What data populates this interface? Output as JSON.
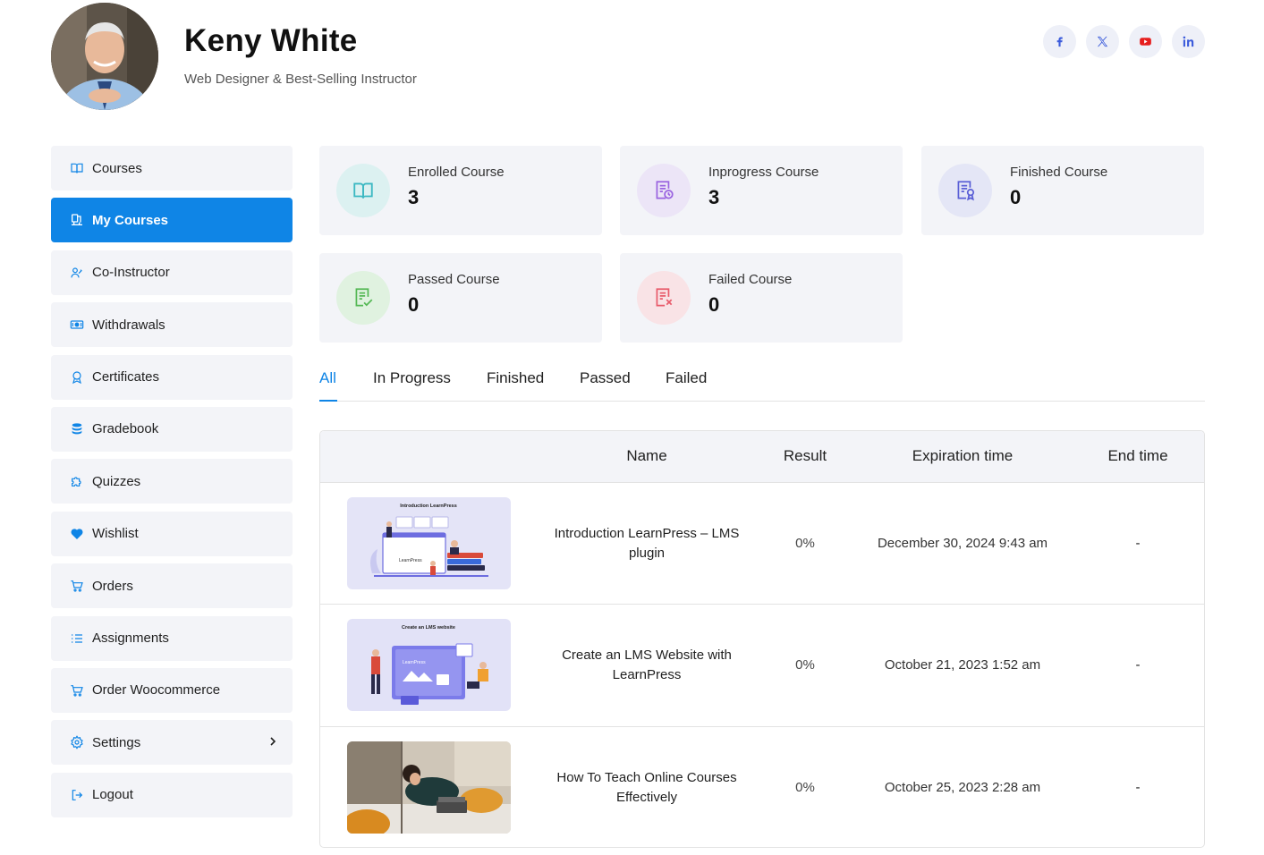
{
  "profile": {
    "name": "Keny White",
    "role": "Web Designer & Best-Selling Instructor"
  },
  "socials": [
    {
      "icon": "facebook-icon",
      "color": "#3b5bdb"
    },
    {
      "icon": "x-icon",
      "color": "#3b5bdb"
    },
    {
      "icon": "youtube-icon",
      "color": "#e61e1e"
    },
    {
      "icon": "linkedin-icon",
      "color": "#3b5bdb"
    }
  ],
  "sidebar": {
    "items": [
      {
        "label": "Courses",
        "icon": "book-icon"
      },
      {
        "label": "My Courses",
        "icon": "my-courses-icon",
        "active": true
      },
      {
        "label": "Co-Instructor",
        "icon": "users-icon"
      },
      {
        "label": "Withdrawals",
        "icon": "money-icon"
      },
      {
        "label": "Certificates",
        "icon": "award-icon"
      },
      {
        "label": "Gradebook",
        "icon": "database-icon"
      },
      {
        "label": "Quizzes",
        "icon": "puzzle-icon"
      },
      {
        "label": "Wishlist",
        "icon": "heart-icon"
      },
      {
        "label": "Orders",
        "icon": "cart-icon"
      },
      {
        "label": "Assignments",
        "icon": "list-icon"
      },
      {
        "label": "Order Woocommerce",
        "icon": "cart-icon"
      },
      {
        "label": "Settings",
        "icon": "gear-icon"
      },
      {
        "label": "Logout",
        "icon": "logout-icon"
      }
    ]
  },
  "stats": [
    {
      "label": "Enrolled Course",
      "value": "3",
      "icon": "open-book-icon",
      "bg": "#dcf1f1",
      "color": "#3bb8c2"
    },
    {
      "label": "Inprogress Course",
      "value": "3",
      "icon": "doc-clock-icon",
      "bg": "#ece5f7",
      "color": "#9a63e0"
    },
    {
      "label": "Finished Course",
      "value": "0",
      "icon": "doc-award-icon",
      "bg": "#e4e6f6",
      "color": "#5a5fd6"
    },
    {
      "label": "Passed Course",
      "value": "0",
      "icon": "doc-check-icon",
      "bg": "#e0f2e0",
      "color": "#55b855"
    },
    {
      "label": "Failed Course",
      "value": "0",
      "icon": "doc-x-icon",
      "bg": "#f9e3e6",
      "color": "#e85b6b"
    }
  ],
  "tabs": [
    "All",
    "In Progress",
    "Finished",
    "Passed",
    "Failed"
  ],
  "table": {
    "headers": {
      "name": "Name",
      "result": "Result",
      "expiration": "Expiration time",
      "end": "End time"
    },
    "rows": [
      {
        "thumb_title": "Introduction LearnPress",
        "thumb_brand": "LearnPress",
        "name": "Introduction LearnPress – LMS plugin",
        "result": "0%",
        "expiration": "December 30, 2024 9:43 am",
        "end": "-"
      },
      {
        "thumb_title": "Create an LMS website",
        "thumb_brand": "LearnPress",
        "name": "Create an LMS Website with LearnPress",
        "result": "0%",
        "expiration": "October 21, 2023 1:52 am",
        "end": "-"
      },
      {
        "thumb_title": "",
        "thumb_brand": "",
        "name": "How To Teach Online Courses Effectively",
        "result": "0%",
        "expiration": "October 25, 2023 2:28 am",
        "end": "-"
      }
    ]
  }
}
